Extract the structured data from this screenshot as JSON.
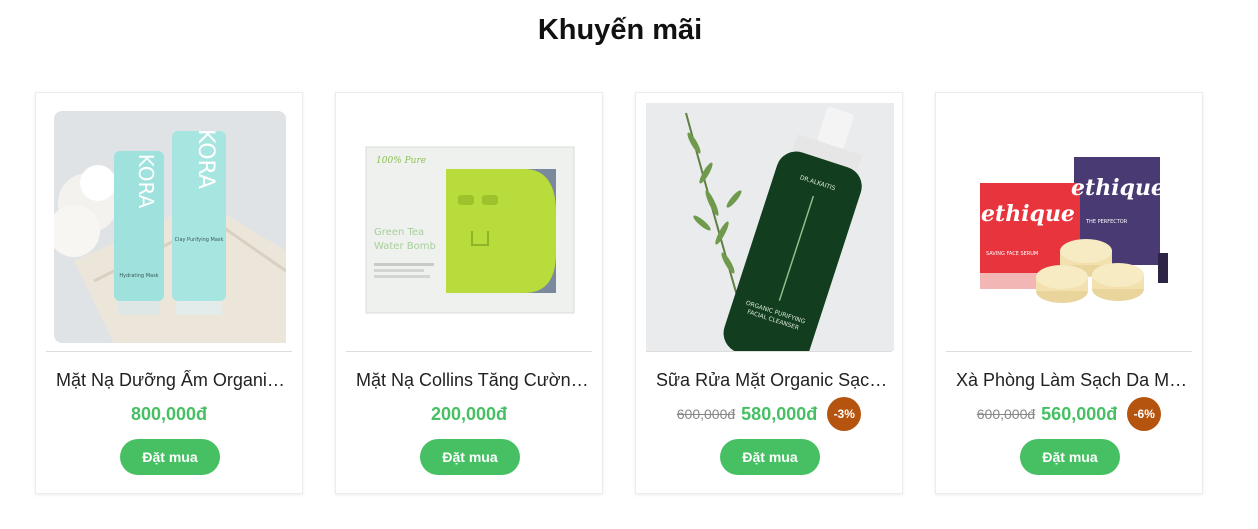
{
  "section": {
    "title": "Khuyến mãi"
  },
  "products": [
    {
      "name": "Mặt Nạ Dưỡng Ẩm Organic Kora",
      "price": "800,000đ",
      "button_label": "Đặt mua",
      "image": {
        "brand_text": "KORA",
        "label_1": "Hydrating Mask",
        "label_2": "Clay Purifying Mask"
      }
    },
    {
      "name": "Mặt Nạ Collins Tăng Cường Collagen",
      "price": "200,000đ",
      "button_label": "Đặt mua",
      "image": {
        "brand_text": "100% Pure",
        "line_1": "Green Tea",
        "line_2": "Water Bomb"
      }
    },
    {
      "name": "Sữa Rửa Mặt Organic Sạch Sâu",
      "old_price": "600,000đ",
      "price": "580,000đ",
      "discount": "-3%",
      "button_label": "Đặt mua",
      "image": {
        "brand_text": "DR.ALKAITIS",
        "line_1": "ORGANIC PURIFYING",
        "line_2": "FACIAL CLEANSER"
      }
    },
    {
      "name": "Xà Phòng Làm Sạch Da Mặt Ethique",
      "old_price": "600,000đ",
      "price": "560,000đ",
      "discount": "-6%",
      "button_label": "Đặt mua",
      "image": {
        "brand_text": "ethique",
        "box_1": "SAVING FACE SERUM",
        "box_2": "THE PERFECTOR"
      }
    }
  ],
  "colors": {
    "accent_green": "#47c064",
    "discount_badge": "#b5540f"
  }
}
